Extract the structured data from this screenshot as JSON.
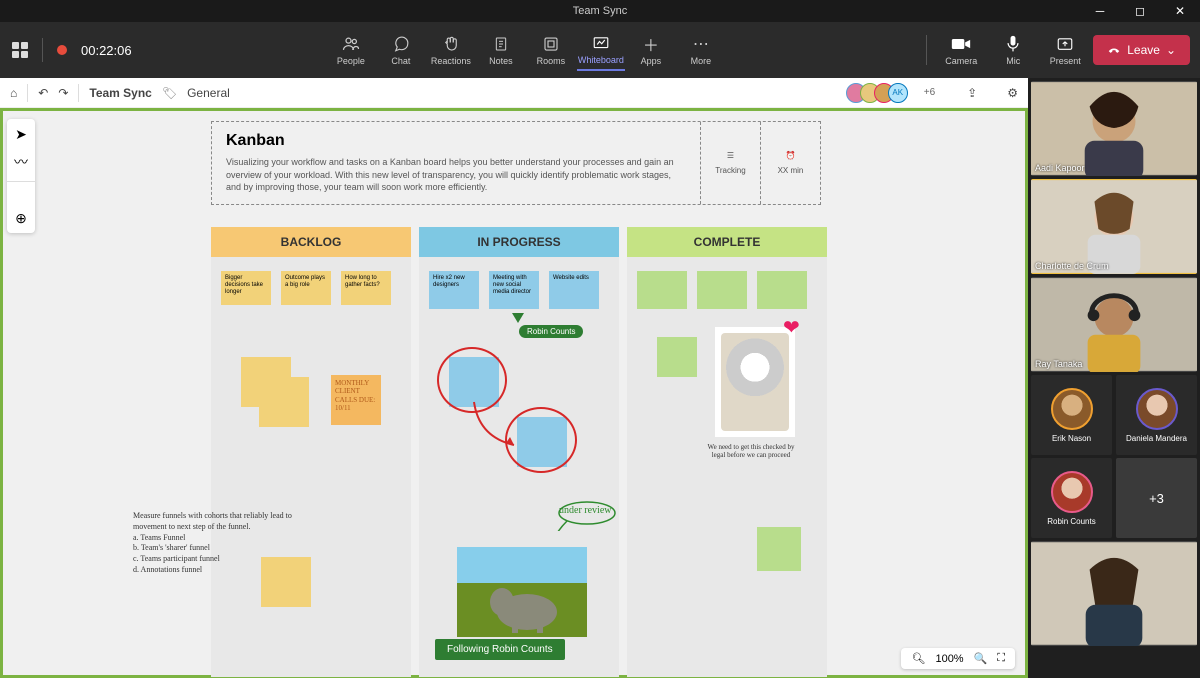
{
  "window": {
    "title": "Team Sync"
  },
  "toolbar": {
    "timer": "00:22:06",
    "items": [
      {
        "label": "People",
        "icon": "people-icon"
      },
      {
        "label": "Chat",
        "icon": "chat-icon"
      },
      {
        "label": "Reactions",
        "icon": "reactions-icon"
      },
      {
        "label": "Notes",
        "icon": "notes-icon"
      },
      {
        "label": "Rooms",
        "icon": "rooms-icon"
      },
      {
        "label": "Whiteboard",
        "icon": "whiteboard-icon",
        "active": true
      },
      {
        "label": "Apps",
        "icon": "apps-icon"
      },
      {
        "label": "More",
        "icon": "more-icon"
      }
    ],
    "right": [
      {
        "label": "Camera",
        "icon": "camera-icon"
      },
      {
        "label": "Mic",
        "icon": "mic-icon"
      },
      {
        "label": "Present",
        "icon": "present-icon"
      }
    ],
    "leave": "Leave"
  },
  "wbheader": {
    "title": "Team Sync",
    "tag": "General",
    "avatar4_initials": "AK",
    "plus_count": "+6"
  },
  "kanban": {
    "title": "Kanban",
    "desc": "Visualizing your workflow and tasks on a Kanban board helps you better understand your processes and gain an overview of your workload. With this new level of transparency, you will quickly identify problematic work stages, and by improving those, your team will soon work more efficiently.",
    "tracking": "Tracking",
    "time": "XX min"
  },
  "columns": {
    "backlog": {
      "header": "BACKLOG",
      "notes": [
        "Bigger decisions take longer",
        "Outcome plays a big role",
        "How long to gather facts?"
      ],
      "orange_note": "MONTHLY CLIENT CALLS DUE: 10/11",
      "handwriting": "Measure funnels with cohorts that reliably lead to movement to next step of the funnel.\n  a. Teams Funnel\n  b. Team's 'sharer' funnel\n  c. Teams participant funnel\n  d. Annotations funnel"
    },
    "inprogress": {
      "header": "IN PROGRESS",
      "notes": [
        "Hire x2 new designers",
        "Meeting with new social media director",
        "Website edits"
      ],
      "cursor_user": "Robin Counts",
      "under_review": "under review"
    },
    "complete": {
      "header": "COMPLETE",
      "caption": "We need to get this checked by legal before we can proceed"
    }
  },
  "follow_bar": "Following Robin Counts",
  "zoom": {
    "level": "100%"
  },
  "participants": {
    "large": [
      {
        "name": "Aadi Kapoor"
      },
      {
        "name": "Charlotte de Crum",
        "active": true
      },
      {
        "name": "Ray Tanaka"
      }
    ],
    "small_row1": [
      {
        "name": "Erik Nason"
      },
      {
        "name": "Daniela Mandera"
      }
    ],
    "small_row2": [
      {
        "name": "Robin Counts"
      },
      {
        "plus": "+3"
      }
    ]
  }
}
